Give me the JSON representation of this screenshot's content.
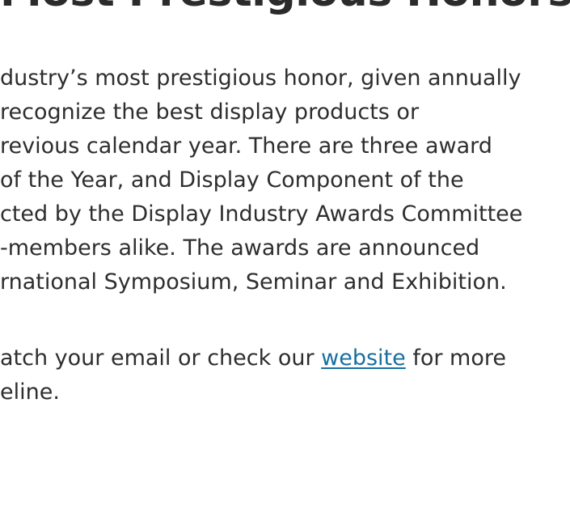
{
  "heading": "Most Prestigious Honors",
  "paragraph1": {
    "lines": [
      "dustry’s most prestigious honor, given annually",
      "recognize the best display products or",
      "revious calendar year. There are three award",
      "of the Year, and Display Component of the",
      "cted by the Display Industry Awards Committee",
      "-members alike. The awards are announced",
      "rnational Symposium, Seminar and Exhibition."
    ]
  },
  "paragraph2": {
    "line1_before": "atch your email or check our ",
    "link_text": "website",
    "line1_after": " for more",
    "line2": "eline."
  },
  "colors": {
    "text": "#2e2e2e",
    "heading": "#2b2b2b",
    "link": "#1a6fa0",
    "background": "#ffffff"
  }
}
